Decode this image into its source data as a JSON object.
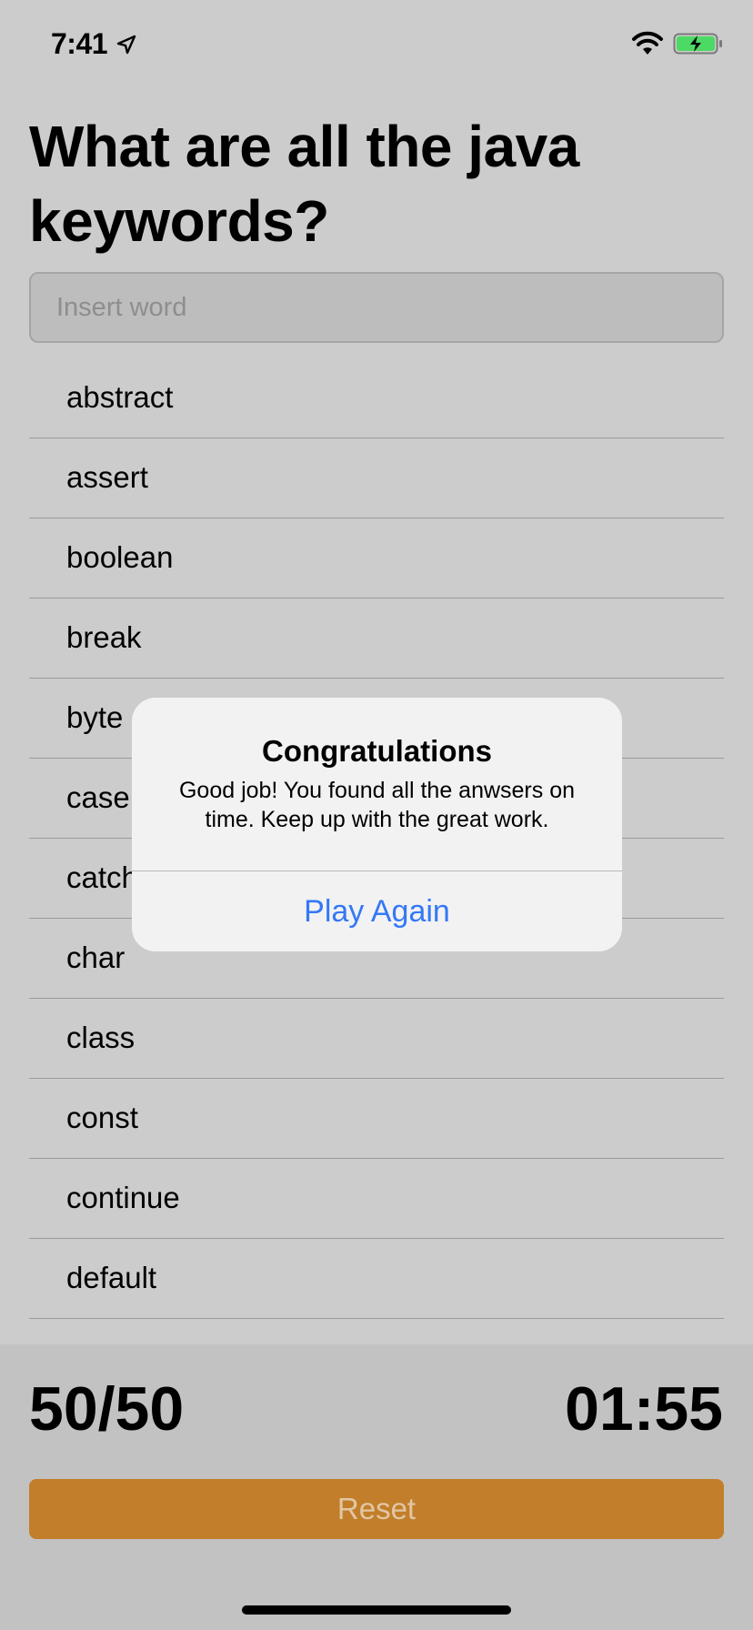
{
  "status_bar": {
    "time": "7:41"
  },
  "title": "What are all the java keywords?",
  "search": {
    "placeholder": "Insert word",
    "value": ""
  },
  "keywords": [
    "abstract",
    "assert",
    "boolean",
    "break",
    "byte",
    "case",
    "catch",
    "char",
    "class",
    "const",
    "continue",
    "default"
  ],
  "footer": {
    "score": "50/50",
    "timer": "01:55",
    "reset_label": "Reset"
  },
  "alert": {
    "title": "Congratulations",
    "message": "Good job! You found all the anwsers on time. Keep up with the great work.",
    "button_label": "Play Again"
  },
  "colors": {
    "accent": "#3478f6",
    "reset_button": "#c27e2b",
    "battery": "#4cd964"
  }
}
